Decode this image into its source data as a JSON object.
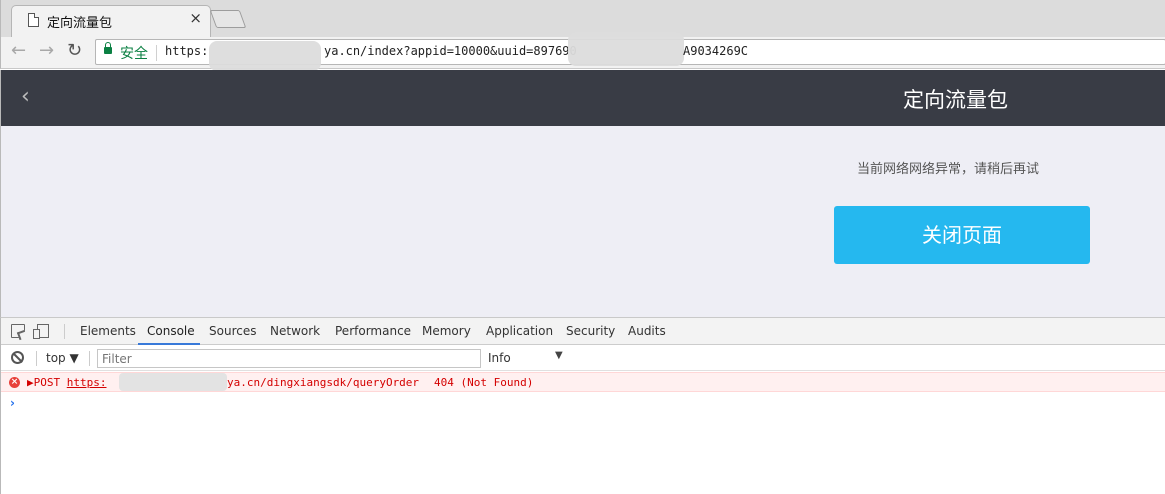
{
  "browser": {
    "tab_title": "定向流量包",
    "tab_close": "×",
    "nav": {
      "back": "←",
      "forward": "→",
      "reload": "↻"
    },
    "secure_label": "安全",
    "url_protocol": "https:",
    "url_host_tail": "ya.cn",
    "url_path": "/index?appid=10000&uuid=897690",
    "url_tail": "A9034269C"
  },
  "page": {
    "back_glyph": "‹",
    "title": "定向流量包",
    "error_message": "当前网络网络异常，请稍后再试",
    "close_button": "关闭页面"
  },
  "devtools": {
    "tabs": [
      "Elements",
      "Console",
      "Sources",
      "Network",
      "Performance",
      "Memory",
      "Application",
      "Security",
      "Audits"
    ],
    "active_tab": "Console",
    "context": "top",
    "filter_placeholder": "Filter",
    "level": "Info",
    "console": {
      "error_method": "POST",
      "error_url_start": "https:",
      "error_url_end": "ya.cn/dingxiangsdk/queryOrder",
      "error_status": "404 (Not Found)",
      "prompt": "›"
    }
  },
  "colors": {
    "header_bg": "#393c45",
    "button_bg": "#25b8ef",
    "page_bg": "#eeeef5",
    "error_red": "#d40000"
  }
}
